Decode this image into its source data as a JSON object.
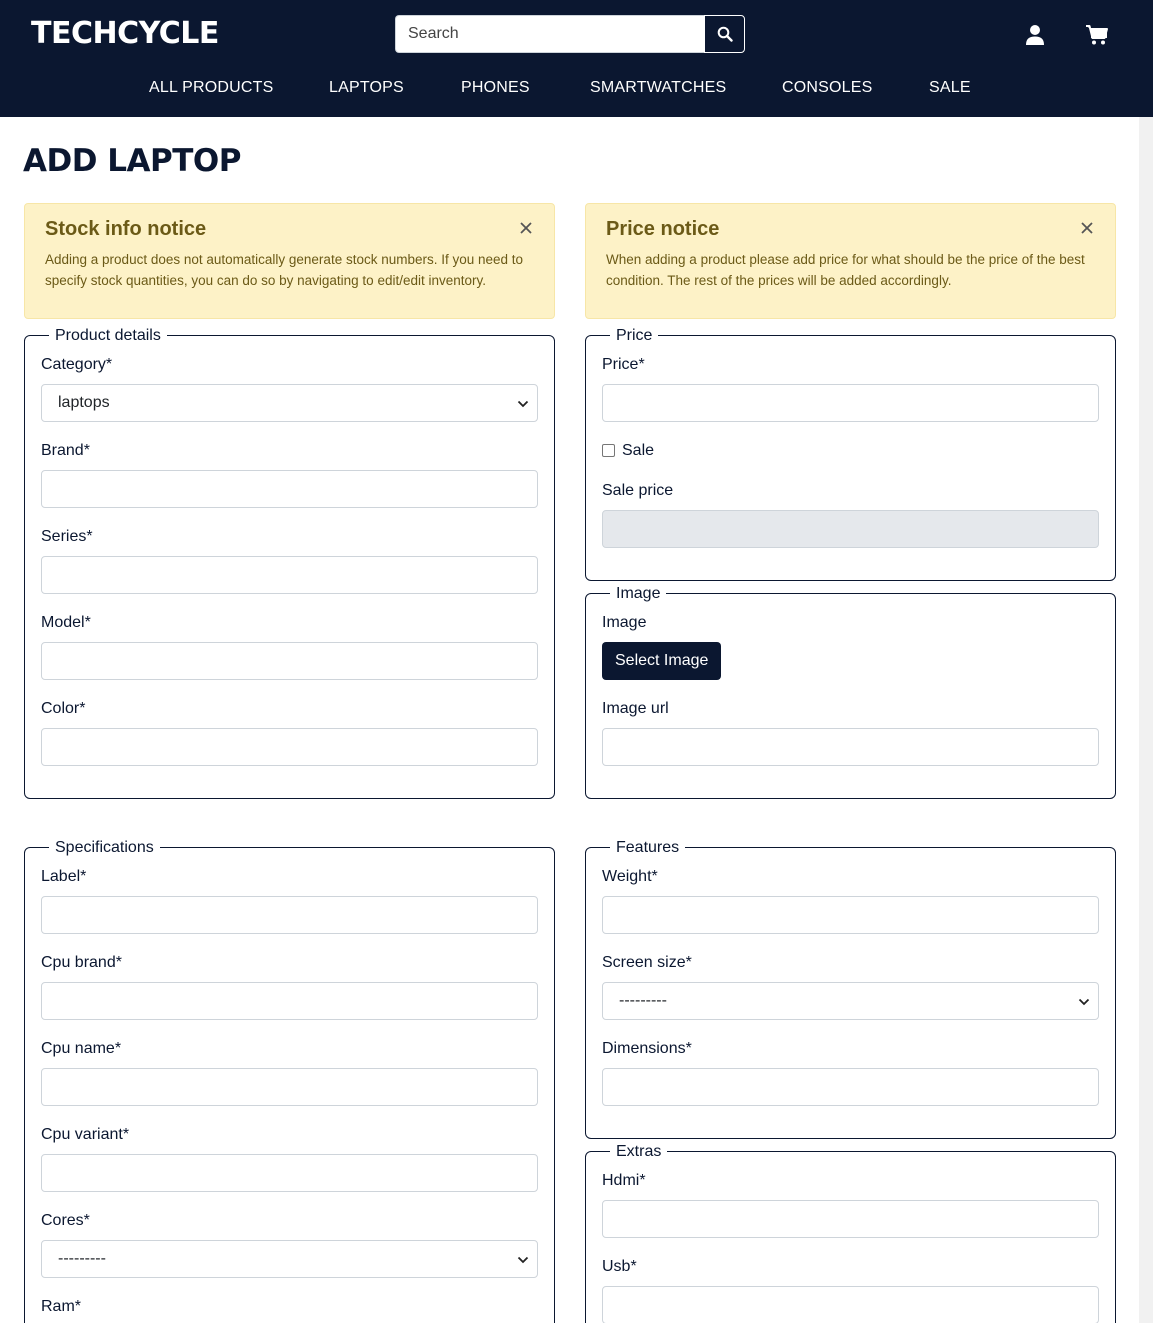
{
  "brand": {
    "logo": "TECHCYCLE"
  },
  "search": {
    "placeholder": "Search"
  },
  "nav": [
    "ALL PRODUCTS",
    "LAPTOPS",
    "PHONES",
    "SMARTWATCHES",
    "CONSOLES",
    "SALE"
  ],
  "page": {
    "title": "ADD LAPTOP"
  },
  "notices": {
    "stock": {
      "title": "Stock info notice",
      "text": "Adding a product does not automatically generate stock numbers. If you need to specify stock quantities, you can do so by navigating to edit/edit inventory."
    },
    "price": {
      "title": "Price notice",
      "text": "When adding a product please add price for what should be the price of the best condition. The rest of the prices will be added accordingly."
    }
  },
  "product_details": {
    "legend": "Product details",
    "category_label": "Category*",
    "category_value": "laptops",
    "brand_label": "Brand*",
    "series_label": "Series*",
    "model_label": "Model*",
    "color_label": "Color*"
  },
  "price": {
    "legend": "Price",
    "price_label": "Price*",
    "sale_label": "Sale",
    "sale_price_label": "Sale price"
  },
  "image": {
    "legend": "Image",
    "image_label": "Image",
    "select_button": "Select Image",
    "url_label": "Image url"
  },
  "specifications": {
    "legend": "Specifications",
    "label_label": "Label*",
    "cpu_brand_label": "Cpu brand*",
    "cpu_name_label": "Cpu name*",
    "cpu_variant_label": "Cpu variant*",
    "cores_label": "Cores*",
    "cores_value": "---------",
    "ram_label": "Ram*"
  },
  "features": {
    "legend": "Features",
    "weight_label": "Weight*",
    "screen_size_label": "Screen size*",
    "screen_size_value": "---------",
    "dimensions_label": "Dimensions*"
  },
  "extras": {
    "legend": "Extras",
    "hdmi_label": "Hdmi*",
    "usb_label": "Usb*"
  },
  "colors": {
    "navy": "#0b1730",
    "notice_bg": "#fdf2c7",
    "notice_text": "#6b5a17",
    "disabled_bg": "#e5e8ec"
  },
  "icons": [
    "search-icon",
    "user-icon",
    "cart-icon",
    "close-icon",
    "chevron-down-icon"
  ]
}
